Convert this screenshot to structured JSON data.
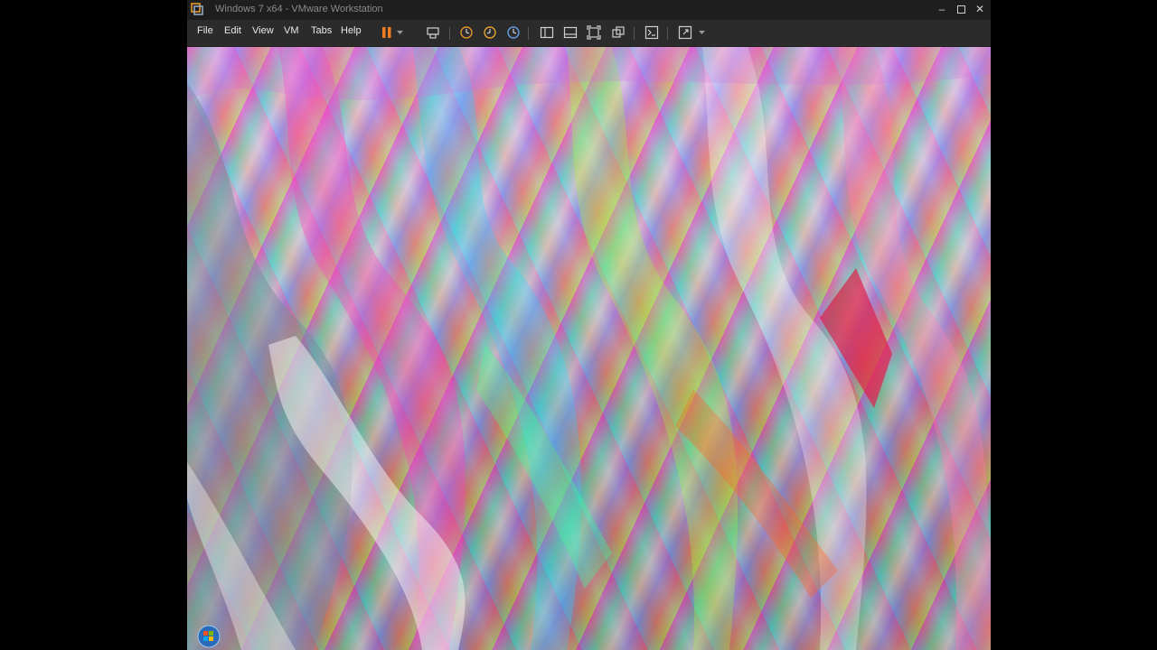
{
  "window": {
    "title": "Windows 7 x64 - VMware Workstation"
  },
  "menu": {
    "file": "File",
    "edit": "Edit",
    "view": "View",
    "vm": "VM",
    "tabs": "Tabs",
    "help": "Help"
  },
  "toolbar": {
    "icons": [
      "pause-icon",
      "dropdown-arrow-icon",
      "send-ctrl-alt-del-icon",
      "snapshot-icon",
      "revert-snapshot-icon",
      "snapshot-manager-icon",
      "library-icon",
      "thumbnail-bar-icon",
      "full-screen-icon",
      "unity-icon",
      "console-icon",
      "stretch-guest-icon",
      "dropdown-arrow-icon"
    ]
  },
  "colors": {
    "titlebar": "#1e1e1e",
    "menubar": "#2b2b2b",
    "pause_accent": "#f07d20"
  }
}
